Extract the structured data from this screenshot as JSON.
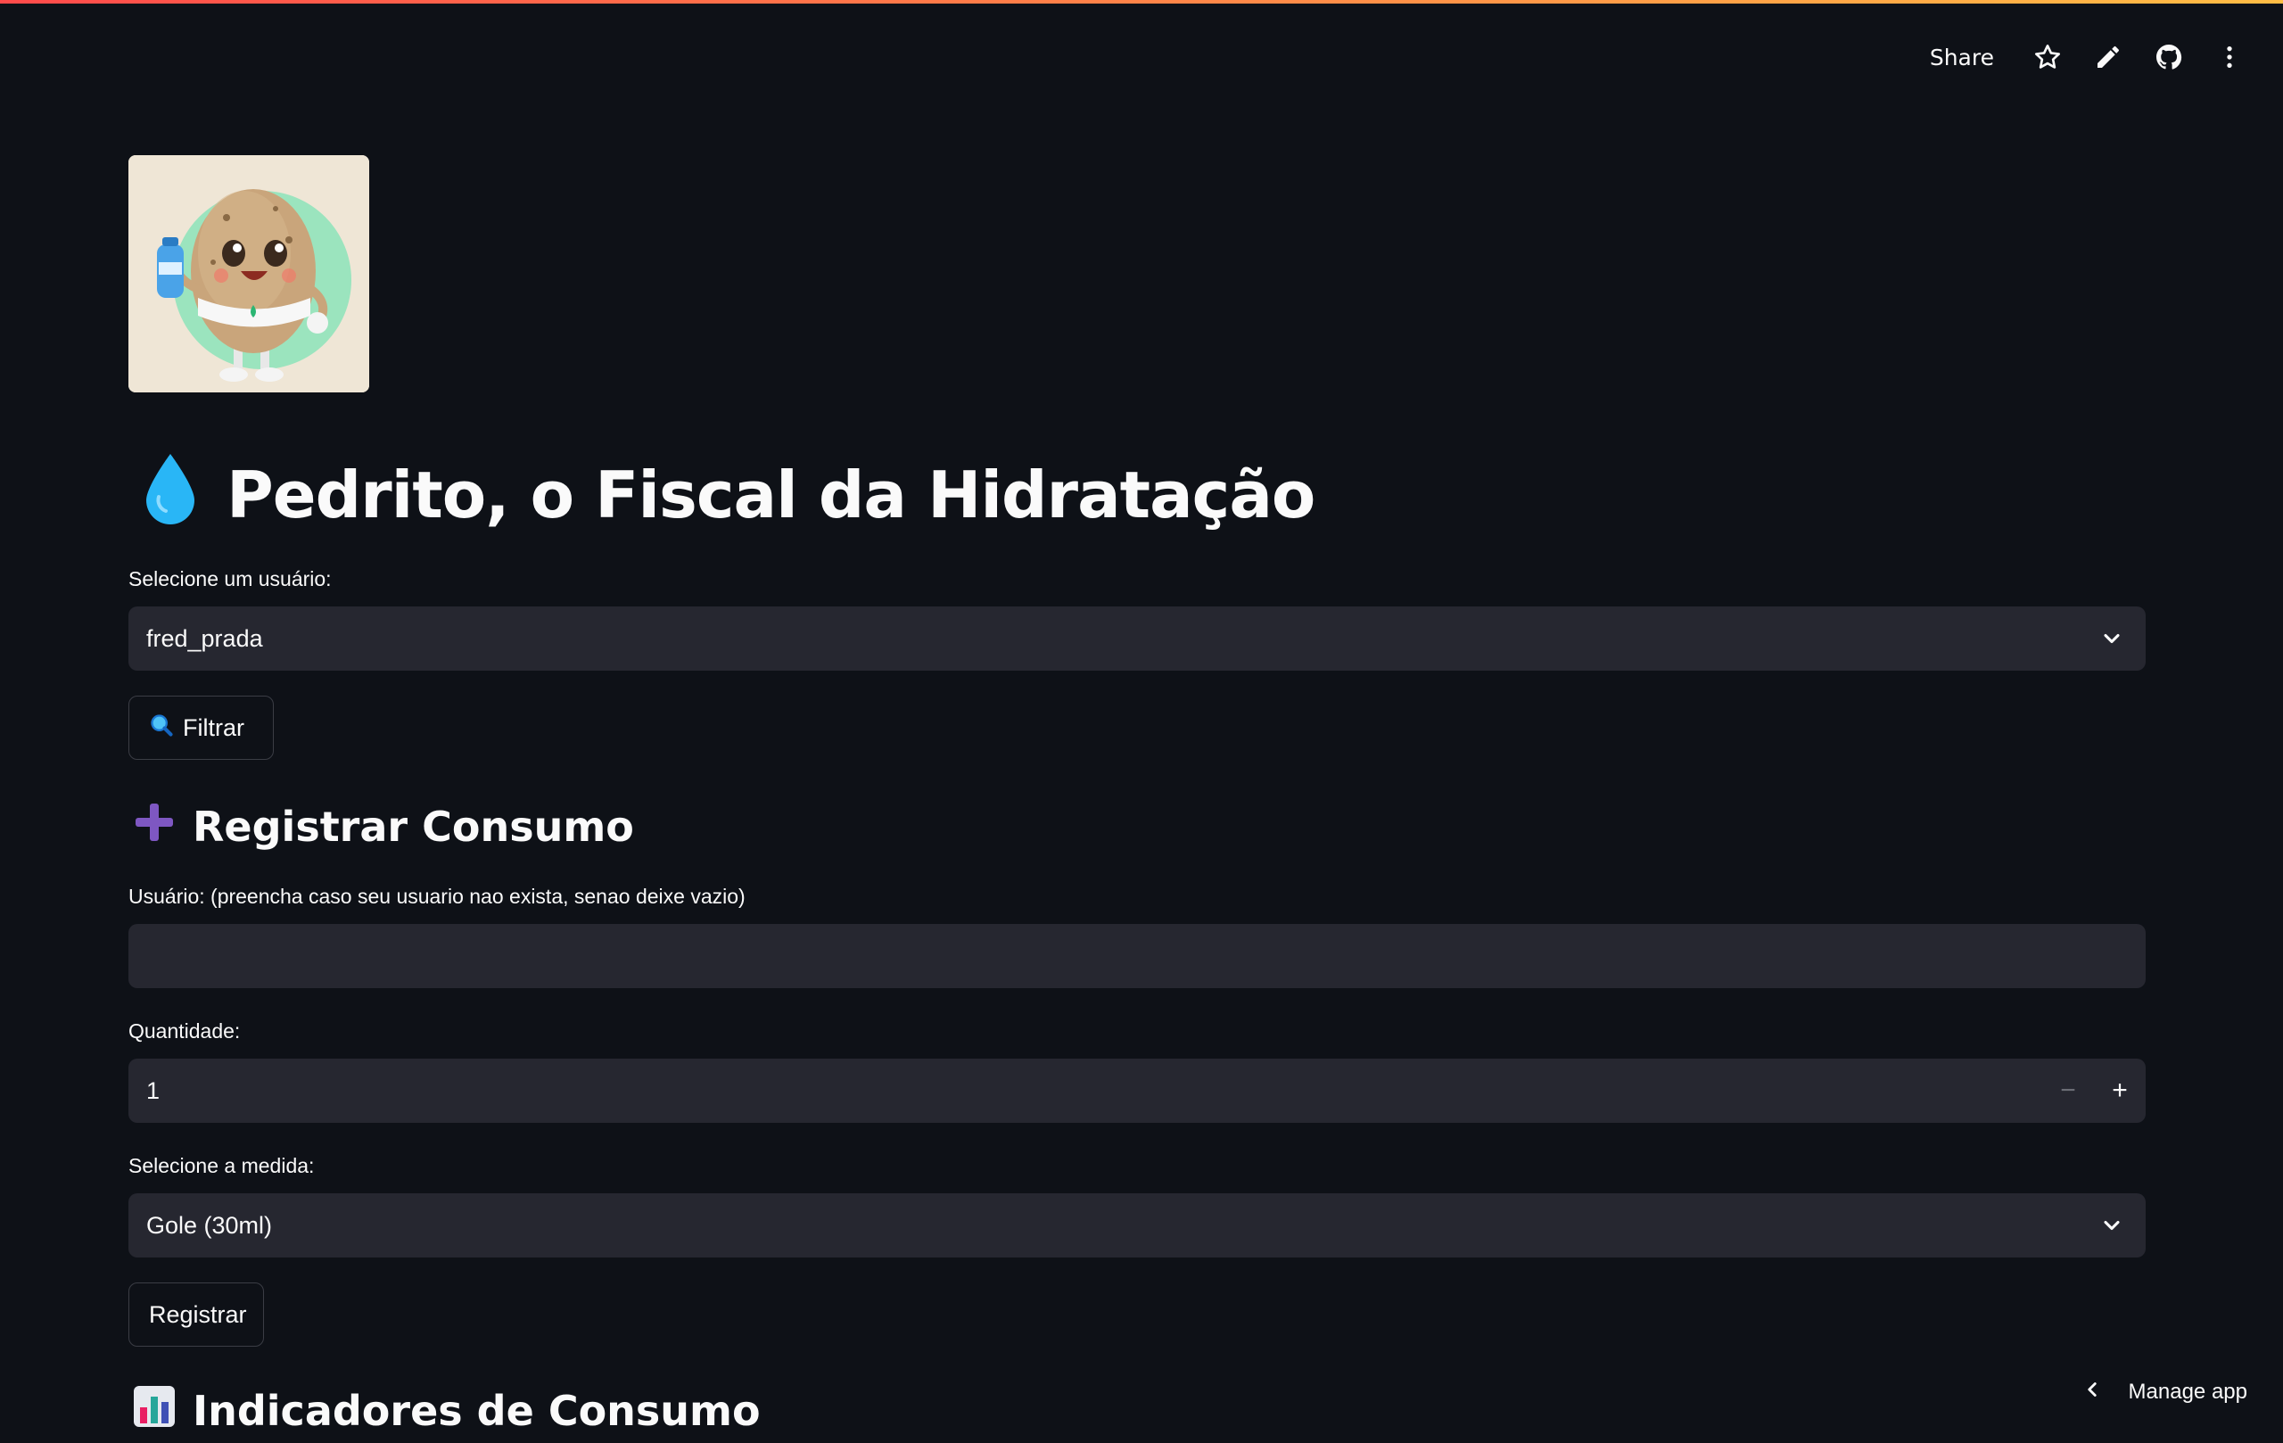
{
  "header": {
    "share_label": "Share",
    "icons": [
      "star-icon",
      "pencil-icon",
      "github-icon",
      "more-vertical-icon"
    ]
  },
  "title": {
    "emoji": "droplet-icon",
    "text": "Pedrito, o Fiscal da Hidratação"
  },
  "user_select": {
    "label": "Selecione um usuário:",
    "value": "fred_prada"
  },
  "filter_button": {
    "icon": "magnifier-icon",
    "label": "Filtrar"
  },
  "register_section": {
    "icon": "plus-icon",
    "title": "Registrar Consumo",
    "user_field": {
      "label": "Usuário: (preencha caso seu usuario nao exista, senao deixe vazio)",
      "value": ""
    },
    "quantity": {
      "label": "Quantidade:",
      "value": "1",
      "decrement": "−",
      "increment": "+"
    },
    "measure_select": {
      "label": "Selecione a medida:",
      "value": "Gole (30ml)"
    },
    "submit_label": "Registrar"
  },
  "indicators_section": {
    "icon": "bar-chart-icon",
    "title": "Indicadores de Consumo"
  },
  "footer": {
    "manage_label": "Manage app"
  },
  "colors": {
    "background": "#0e1117",
    "input_bg": "#262730",
    "accent_gradient_start": "#ff4b4b",
    "accent_gradient_end": "#ffbd45",
    "droplet": "#29b6f6",
    "plus": "#7e57c2"
  }
}
